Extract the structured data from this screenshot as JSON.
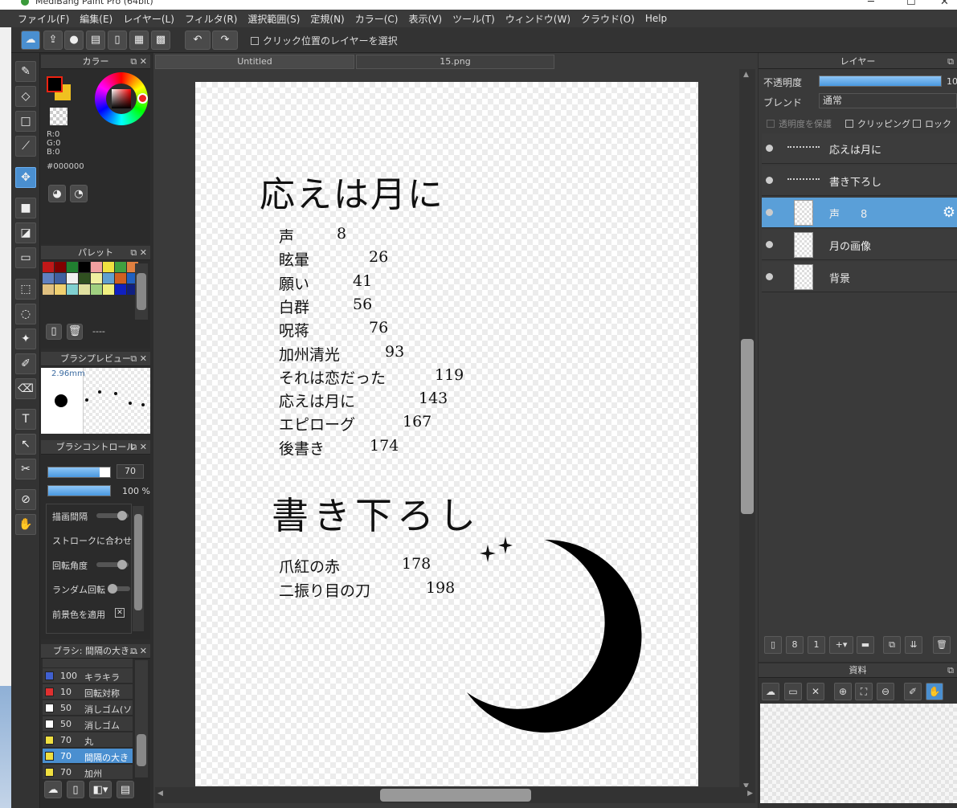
{
  "window": {
    "title": "MediBang Paint Pro (64bit)"
  },
  "menu": [
    "ファイル(F)",
    "編集(E)",
    "レイヤー(L)",
    "フィルタ(R)",
    "選択範囲(S)",
    "定規(N)",
    "カラー(C)",
    "表示(V)",
    "ツール(T)",
    "ウィンドウ(W)",
    "クラウド(O)",
    "Help"
  ],
  "toolbar": {
    "select_layer_checkbox_label": "クリック位置のレイヤーを選択"
  },
  "color_panel": {
    "title": "カラー",
    "r": "R:0",
    "g": "G:0",
    "b": "B:0",
    "hex": "#000000",
    "fg_color": "#000000",
    "bg_color": "#f0c020"
  },
  "palette_panel": {
    "title": "パレット",
    "name": "----",
    "colors": [
      "#c01818",
      "#800000",
      "#208030",
      "#000000",
      "#f0a0a0",
      "#f0e040",
      "#40a040",
      "#e08040",
      "#6080c0",
      "#4060a0",
      "#f0f0f0",
      "#305020",
      "#f0f0a0",
      "#60a0d0",
      "#d06020",
      "#2060c0",
      "#e0c080",
      "#f0d070",
      "#80d0d0",
      "#e0e0a0",
      "#a0d080",
      "#f0f080",
      "#1020c0",
      "#102080"
    ]
  },
  "brush_preview": {
    "title": "ブラシプレビュー",
    "size": "2.96mm"
  },
  "brush_control": {
    "title": "ブラシコントロール",
    "size_value": "70",
    "opacity_value": "100 %",
    "rows": [
      "描画間隔",
      "ストロークに合わせて回",
      "回転角度",
      "ランダム回転",
      "前景色を適用"
    ]
  },
  "brush_list": {
    "title": "ブラシ: 間隔の大き…",
    "items": [
      {
        "color": "#4060d0",
        "size": "100",
        "name": "キラキラ"
      },
      {
        "color": "#e03030",
        "size": "10",
        "name": "回転対称"
      },
      {
        "color": "#ffffff",
        "size": "50",
        "name": "消しゴム(ソフ"
      },
      {
        "color": "#ffffff",
        "size": "50",
        "name": "消しゴム"
      },
      {
        "color": "#f0e040",
        "size": "70",
        "name": "丸"
      },
      {
        "color": "#f0e040",
        "size": "70",
        "name": "間隔の大き"
      },
      {
        "color": "#f0e040",
        "size": "70",
        "name": "加州"
      }
    ]
  },
  "tabs": [
    {
      "label": "Untitled"
    },
    {
      "label": "15.png"
    }
  ],
  "canvas": {
    "title1": "応えは月に",
    "toc1": [
      {
        "t": "声",
        "p": "8"
      },
      {
        "t": "眩暈",
        "p": "26"
      },
      {
        "t": "願い",
        "p": "41"
      },
      {
        "t": "白群",
        "p": "56"
      },
      {
        "t": "呪蒋",
        "p": "76"
      },
      {
        "t": "加州清光",
        "p": "93"
      },
      {
        "t": "それは恋だった",
        "p": "119"
      },
      {
        "t": "応えは月に",
        "p": "143"
      },
      {
        "t": "エピローグ",
        "p": "167"
      },
      {
        "t": "後書き",
        "p": "174"
      }
    ],
    "title2": "書き下ろし",
    "toc2": [
      {
        "t": "爪紅の赤",
        "p": "178"
      },
      {
        "t": "二振り目の刀",
        "p": "198"
      }
    ]
  },
  "layers_panel": {
    "title": "レイヤー",
    "opacity_label": "不透明度",
    "opacity_value": "10",
    "blend_label": "ブレンド",
    "blend_value": "通常",
    "protect_label": "透明度を保護",
    "clipping_label": "クリッピング",
    "lock_label": "ロック",
    "layers": [
      {
        "name": "応えは月に"
      },
      {
        "name": "書き下ろし"
      },
      {
        "name": "声　　8"
      },
      {
        "name": "月の画像"
      },
      {
        "name": "背景"
      }
    ]
  },
  "materials_panel": {
    "title": "資料"
  }
}
